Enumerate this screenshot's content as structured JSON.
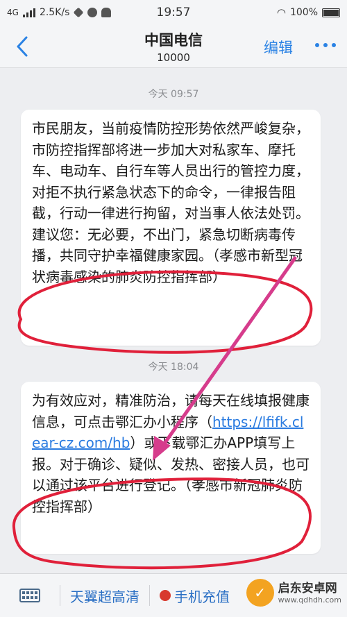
{
  "status_bar": {
    "network": "4G",
    "speed": "2.5K/s",
    "time": "19:57",
    "battery": "100%"
  },
  "nav": {
    "title": "中国电信",
    "subtitle": "10000",
    "edit_label": "编辑"
  },
  "messages": [
    {
      "time": "今天 09:57",
      "text": "市民朋友，当前疫情防控形势依然严峻复杂，市防控指挥部将进一步加大对私家车、摩托车、电动车、自行车等人员出行的管控力度，对拒不执行紧急状态下的命令，一律报告阻截，行动一律进行拘留，对当事人依法处罚。建议您：无必要，不出门，紧急切断病毒传播，共同守护幸福健康家园。（孝感市新型冠状病毒感染的肺炎防控指挥部）"
    },
    {
      "time": "今天 18:04",
      "text_before": "为有效应对，精准防治，请每天在线填报健康信息，可点击鄂汇办小程序（",
      "link": "https://lfifk.clear-cz.com/hb",
      "text_after": "）或下载鄂汇办APP填写上报。对于确诊、疑似、发热、密接人员，也可以通过该平台进行登记。（孝感市新冠肺炎防控指挥部）"
    }
  ],
  "toolbar": {
    "btn1": "天翼超高清",
    "btn2": "手机充值"
  },
  "watermark": {
    "name": "启东安卓网",
    "url": "www.qdhdh.com"
  },
  "colors": {
    "accent": "#2a82e4",
    "annotation": "#e0203a",
    "arrow": "#d63c8c"
  }
}
